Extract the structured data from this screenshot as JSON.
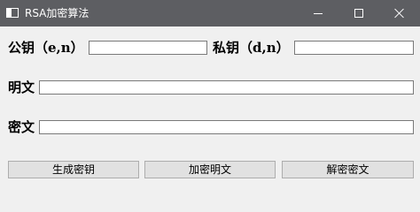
{
  "window": {
    "title": "RSA加密算法"
  },
  "public_key": {
    "label": "公钥（e,n）",
    "value": ""
  },
  "private_key": {
    "label": "私钥（d,n）",
    "value": ""
  },
  "plaintext": {
    "label": "明文",
    "value": ""
  },
  "ciphertext": {
    "label": "密文",
    "value": ""
  },
  "buttons": {
    "generate": "生成密钥",
    "encrypt": "加密明文",
    "decrypt": "解密密文"
  }
}
